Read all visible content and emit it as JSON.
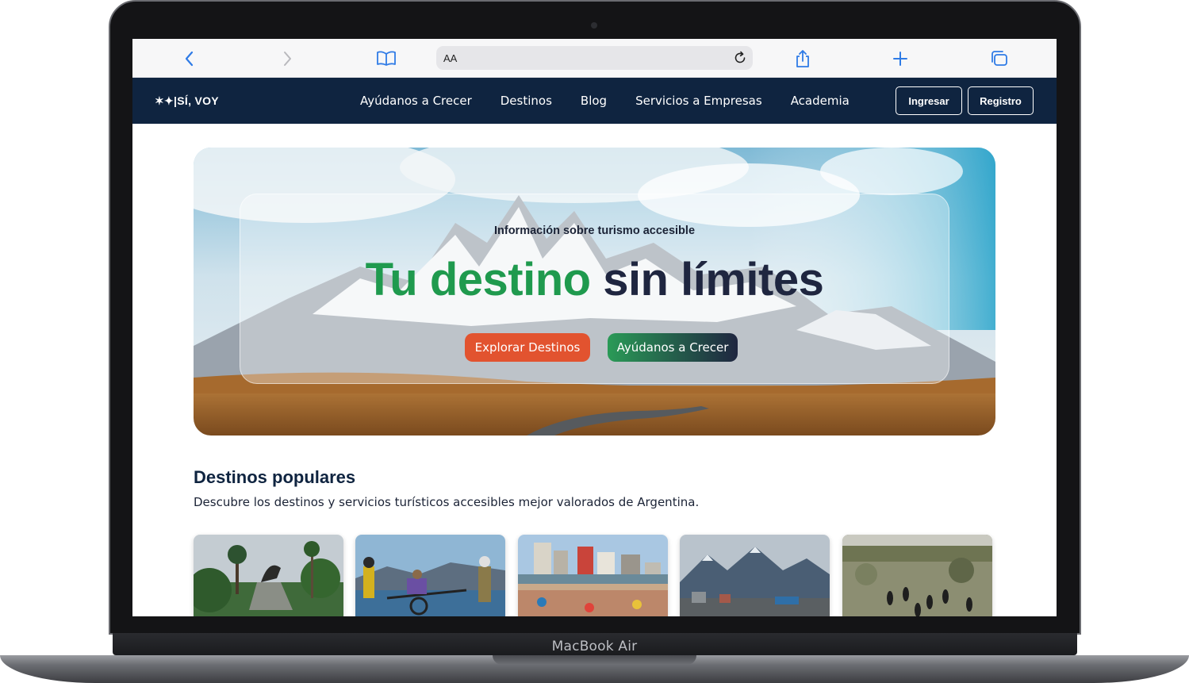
{
  "device": {
    "label": "MacBook Air"
  },
  "browser": {
    "address_text": "AA"
  },
  "site": {
    "logo_text": "✶✦|SÍ, VOY",
    "nav": [
      "Ayúdanos a Crecer",
      "Destinos",
      "Blog",
      "Servicios a Empresas",
      "Academia"
    ],
    "login_label": "Ingresar",
    "register_label": "Registro"
  },
  "hero": {
    "eyebrow": "Información sobre turismo accesible",
    "headline_green": "Tu destino",
    "headline_dark": "sin límites",
    "primary_cta": "Explorar Destinos",
    "secondary_cta": "Ayúdanos a Crecer"
  },
  "popular": {
    "title": "Destinos populares",
    "subtitle": "Descubre los destinos y servicios turísticos accesibles mejor valorados de Argentina.",
    "cards": [
      "monument-photo",
      "adaptive-hiking-photo",
      "beach-city-photo",
      "mountain-town-photo",
      "penguin-colony-photo"
    ]
  },
  "colors": {
    "nav_bg": "#0f2440",
    "green": "#1f9a4e",
    "orange": "#e2532f",
    "dark": "#1f2640"
  }
}
